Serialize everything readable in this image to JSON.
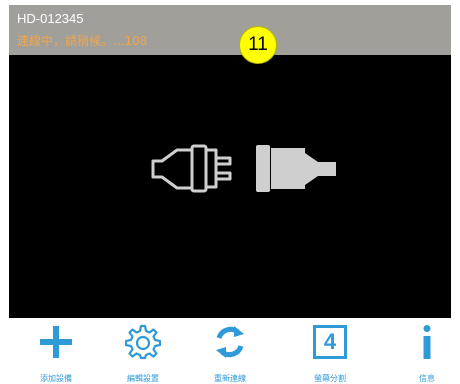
{
  "header": {
    "device_id": "HD-012345",
    "status": "連線中，請稍候。...108"
  },
  "badge": {
    "number": "11"
  },
  "toolbar": {
    "items": [
      {
        "label": "添加設備",
        "icon": "plus-icon"
      },
      {
        "label": "編輯設置",
        "icon": "gear-icon"
      },
      {
        "label": "重新連線",
        "icon": "refresh-icon"
      },
      {
        "label": "螢幕分割",
        "icon": "split-screen-icon",
        "icon_text": "4"
      },
      {
        "label": "信息",
        "icon": "info-icon"
      }
    ]
  },
  "colors": {
    "header_bg": "#a09f9a",
    "status_text": "#f0a64b",
    "accent": "#2f9ad8",
    "video_bg": "#000000",
    "badge": "#ffff00"
  }
}
